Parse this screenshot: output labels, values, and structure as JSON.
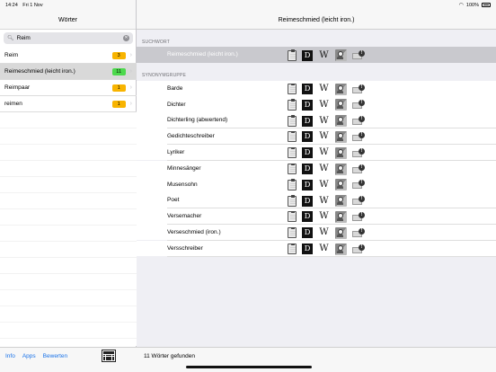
{
  "status": {
    "time": "14:24",
    "date": "Fri 1 Nov",
    "battery": "100%"
  },
  "sidebar": {
    "title": "Wörter",
    "search": {
      "value": "Reim"
    },
    "items": [
      {
        "label": "Reim",
        "count": "3",
        "color": "#f8b400"
      },
      {
        "label": "Reimeschmied (leicht iron.)",
        "count": "11",
        "color": "#4cd94c",
        "selected": true
      },
      {
        "label": "Reimpaar",
        "count": "1",
        "color": "#f8b400"
      },
      {
        "label": "reimen",
        "count": "1",
        "color": "#f8b400"
      }
    ],
    "footer": {
      "info": "Info",
      "apps": "Apps",
      "rate": "Bewerten"
    }
  },
  "main": {
    "title": "Reimeschmied (leicht iron.)",
    "suchwort_label": "SUCHWORT",
    "suchwort": "Reimeschmied (leicht iron.)",
    "synonym_label": "SYNONYMGRUPPE",
    "synonyms": [
      "Barde",
      "Dichter",
      "Dichterling (abwertend)",
      "Gedichteschreiber",
      "Lyriker",
      "Minnesänger",
      "Musensohn",
      "Poet",
      "Versemacher",
      "Verseschmied (iron.)",
      "Versschreiber"
    ],
    "icon_labels": {
      "d": "D",
      "w": "W",
      "mail": "!"
    },
    "footer_text": "11 Wörter gefunden"
  }
}
